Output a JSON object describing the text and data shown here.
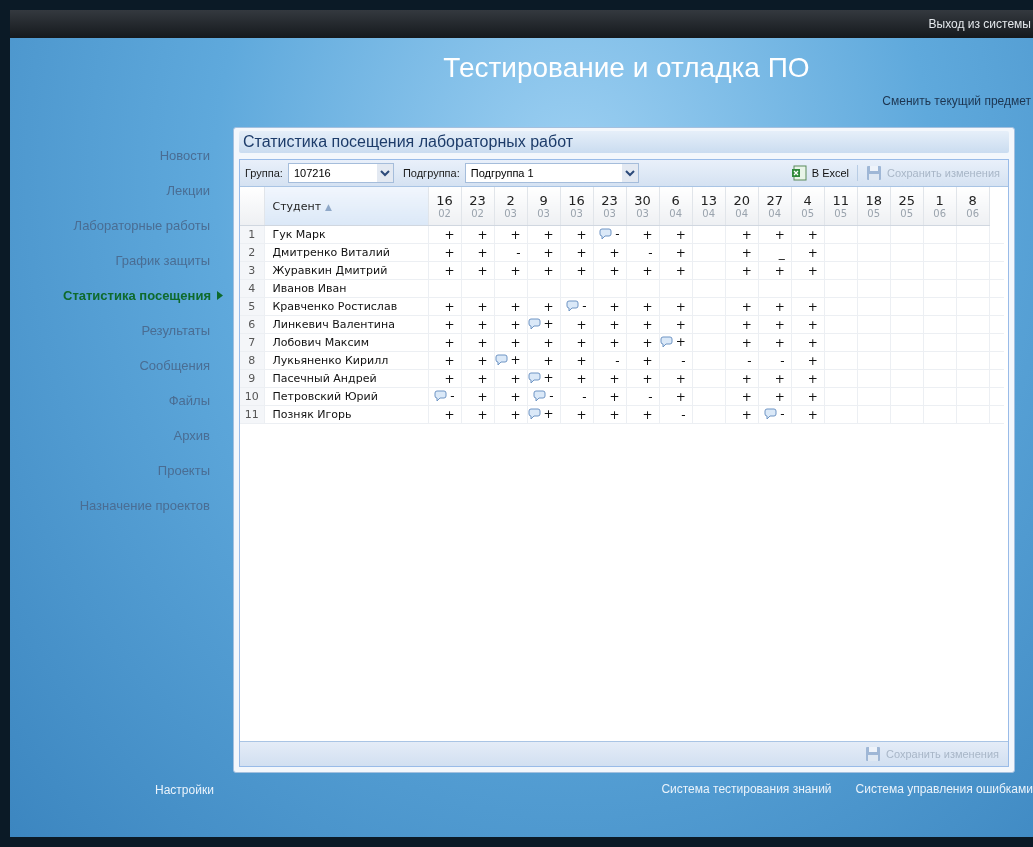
{
  "top_bar": {
    "logout_link": "Выход из системы"
  },
  "header": {
    "title": "Тестирование и отладка ПО",
    "change_subject_link": "Сменить текущий предмет"
  },
  "sidebar": {
    "items": [
      {
        "label": "Новости",
        "selected": false
      },
      {
        "label": "Лекции",
        "selected": false
      },
      {
        "label": "Лабораторные работы",
        "selected": false
      },
      {
        "label": "График защиты",
        "selected": false
      },
      {
        "label": "Статистика посещения",
        "selected": true
      },
      {
        "label": "Результаты",
        "selected": false
      },
      {
        "label": "Сообщения",
        "selected": false
      },
      {
        "label": "Файлы",
        "selected": false
      },
      {
        "label": "Архив",
        "selected": false
      },
      {
        "label": "Проекты",
        "selected": false
      },
      {
        "label": "Назначение проектов",
        "selected": false
      }
    ]
  },
  "panel": {
    "title": "Статистика посещения лабораторных работ",
    "toolbar": {
      "group_label": "Группа:",
      "group_value": "107216",
      "subgroup_label": "Подгруппа:",
      "subgroup_value": "Подгруппа 1",
      "excel_button": "В Excel",
      "save_button": {
        "label": "Сохранить изменения",
        "disabled": true
      }
    },
    "table": {
      "student_column": "Студент",
      "sort_indicator": "▲",
      "dates": [
        {
          "day": "16",
          "month": "02"
        },
        {
          "day": "23",
          "month": "02"
        },
        {
          "day": "2",
          "month": "03"
        },
        {
          "day": "9",
          "month": "03"
        },
        {
          "day": "16",
          "month": "03"
        },
        {
          "day": "23",
          "month": "03"
        },
        {
          "day": "30",
          "month": "03"
        },
        {
          "day": "6",
          "month": "04"
        },
        {
          "day": "13",
          "month": "04"
        },
        {
          "day": "20",
          "month": "04"
        },
        {
          "day": "27",
          "month": "04"
        },
        {
          "day": "4",
          "month": "05"
        },
        {
          "day": "11",
          "month": "05"
        },
        {
          "day": "18",
          "month": "05"
        },
        {
          "day": "25",
          "month": "05"
        },
        {
          "day": "1",
          "month": "06"
        },
        {
          "day": "8",
          "month": "06"
        }
      ],
      "rows": [
        {
          "num": "1",
          "student": "Гук Марк",
          "cells": [
            {
              "mark": "+",
              "comment": false
            },
            {
              "mark": "+",
              "comment": false
            },
            {
              "mark": "+",
              "comment": false
            },
            {
              "mark": "+",
              "comment": false
            },
            {
              "mark": "+",
              "comment": false
            },
            {
              "mark": "-",
              "comment": true
            },
            {
              "mark": "+",
              "comment": false
            },
            {
              "mark": "+",
              "comment": false
            },
            null,
            {
              "mark": "+",
              "comment": false
            },
            {
              "mark": "+",
              "comment": false
            },
            {
              "mark": "+",
              "comment": false
            },
            null,
            null,
            null,
            null,
            null
          ]
        },
        {
          "num": "2",
          "student": "Дмитренко Виталий",
          "cells": [
            {
              "mark": "+",
              "comment": false
            },
            {
              "mark": "+",
              "comment": false
            },
            {
              "mark": "-",
              "comment": false
            },
            {
              "mark": "+",
              "comment": false
            },
            {
              "mark": "+",
              "comment": false
            },
            {
              "mark": "+",
              "comment": false
            },
            {
              "mark": "-",
              "comment": false
            },
            {
              "mark": "+",
              "comment": false
            },
            null,
            {
              "mark": "+",
              "comment": false
            },
            {
              "mark": "_",
              "comment": false
            },
            {
              "mark": "+",
              "comment": false
            },
            null,
            null,
            null,
            null,
            null
          ]
        },
        {
          "num": "3",
          "student": "Журавкин Дмитрий",
          "cells": [
            {
              "mark": "+",
              "comment": false
            },
            {
              "mark": "+",
              "comment": false
            },
            {
              "mark": "+",
              "comment": false
            },
            {
              "mark": "+",
              "comment": false
            },
            {
              "mark": "+",
              "comment": false
            },
            {
              "mark": "+",
              "comment": false
            },
            {
              "mark": "+",
              "comment": false
            },
            {
              "mark": "+",
              "comment": false
            },
            null,
            {
              "mark": "+",
              "comment": false
            },
            {
              "mark": "+",
              "comment": false
            },
            {
              "mark": "+",
              "comment": false
            },
            null,
            null,
            null,
            null,
            null
          ]
        },
        {
          "num": "4",
          "student": "Иванов Иван",
          "cells": [
            null,
            null,
            null,
            null,
            null,
            null,
            null,
            null,
            null,
            null,
            null,
            null,
            null,
            null,
            null,
            null,
            null
          ]
        },
        {
          "num": "5",
          "student": "Кравченко Ростислав",
          "cells": [
            {
              "mark": "+",
              "comment": false
            },
            {
              "mark": "+",
              "comment": false
            },
            {
              "mark": "+",
              "comment": false
            },
            {
              "mark": "+",
              "comment": false
            },
            {
              "mark": "-",
              "comment": true
            },
            {
              "mark": "+",
              "comment": false
            },
            {
              "mark": "+",
              "comment": false
            },
            {
              "mark": "+",
              "comment": false
            },
            null,
            {
              "mark": "+",
              "comment": false
            },
            {
              "mark": "+",
              "comment": false
            },
            {
              "mark": "+",
              "comment": false
            },
            null,
            null,
            null,
            null,
            null
          ]
        },
        {
          "num": "6",
          "student": "Линкевич Валентина",
          "cells": [
            {
              "mark": "+",
              "comment": false
            },
            {
              "mark": "+",
              "comment": false
            },
            {
              "mark": "+",
              "comment": false
            },
            {
              "mark": "+",
              "comment": true
            },
            {
              "mark": "+",
              "comment": false
            },
            {
              "mark": "+",
              "comment": false
            },
            {
              "mark": "+",
              "comment": false
            },
            {
              "mark": "+",
              "comment": false
            },
            null,
            {
              "mark": "+",
              "comment": false
            },
            {
              "mark": "+",
              "comment": false
            },
            {
              "mark": "+",
              "comment": false
            },
            null,
            null,
            null,
            null,
            null
          ]
        },
        {
          "num": "7",
          "student": "Лобович Максим",
          "cells": [
            {
              "mark": "+",
              "comment": false
            },
            {
              "mark": "+",
              "comment": false
            },
            {
              "mark": "+",
              "comment": false
            },
            {
              "mark": "+",
              "comment": false
            },
            {
              "mark": "+",
              "comment": false
            },
            {
              "mark": "+",
              "comment": false
            },
            {
              "mark": "+",
              "comment": false
            },
            {
              "mark": "+",
              "comment": true
            },
            null,
            {
              "mark": "+",
              "comment": false
            },
            {
              "mark": "+",
              "comment": false
            },
            {
              "mark": "+",
              "comment": false
            },
            null,
            null,
            null,
            null,
            null
          ]
        },
        {
          "num": "8",
          "student": "Лукьяненко Кирилл",
          "cells": [
            {
              "mark": "+",
              "comment": false
            },
            {
              "mark": "+",
              "comment": false
            },
            {
              "mark": "+",
              "comment": true
            },
            {
              "mark": "+",
              "comment": false
            },
            {
              "mark": "+",
              "comment": false
            },
            {
              "mark": "-",
              "comment": false
            },
            {
              "mark": "+",
              "comment": false
            },
            {
              "mark": "-",
              "comment": false
            },
            null,
            {
              "mark": "-",
              "comment": false
            },
            {
              "mark": "-",
              "comment": false
            },
            {
              "mark": "+",
              "comment": false
            },
            null,
            null,
            null,
            null,
            null
          ]
        },
        {
          "num": "9",
          "student": "Пасечный Андрей",
          "cells": [
            {
              "mark": "+",
              "comment": false
            },
            {
              "mark": "+",
              "comment": false
            },
            {
              "mark": "+",
              "comment": false
            },
            {
              "mark": "+",
              "comment": true
            },
            {
              "mark": "+",
              "comment": false
            },
            {
              "mark": "+",
              "comment": false
            },
            {
              "mark": "+",
              "comment": false
            },
            {
              "mark": "+",
              "comment": false
            },
            null,
            {
              "mark": "+",
              "comment": false
            },
            {
              "mark": "+",
              "comment": false
            },
            {
              "mark": "+",
              "comment": false
            },
            null,
            null,
            null,
            null,
            null
          ]
        },
        {
          "num": "10",
          "student": "Петровский Юрий",
          "cells": [
            {
              "mark": "-",
              "comment": true
            },
            {
              "mark": "+",
              "comment": false
            },
            {
              "mark": "+",
              "comment": false
            },
            {
              "mark": "-",
              "comment": true
            },
            {
              "mark": "-",
              "comment": false
            },
            {
              "mark": "+",
              "comment": false
            },
            {
              "mark": "-",
              "comment": false
            },
            {
              "mark": "+",
              "comment": false
            },
            null,
            {
              "mark": "+",
              "comment": false
            },
            {
              "mark": "+",
              "comment": false
            },
            {
              "mark": "+",
              "comment": false
            },
            null,
            null,
            null,
            null,
            null
          ]
        },
        {
          "num": "11",
          "student": "Позняк Игорь",
          "cells": [
            {
              "mark": "+",
              "comment": false
            },
            {
              "mark": "+",
              "comment": false
            },
            {
              "mark": "+",
              "comment": false
            },
            {
              "mark": "+",
              "comment": true
            },
            {
              "mark": "+",
              "comment": false
            },
            {
              "mark": "+",
              "comment": false
            },
            {
              "mark": "+",
              "comment": false
            },
            {
              "mark": "-",
              "comment": false
            },
            null,
            {
              "mark": "+",
              "comment": false
            },
            {
              "mark": "-",
              "comment": true
            },
            {
              "mark": "+",
              "comment": false
            },
            null,
            null,
            null,
            null,
            null
          ]
        }
      ]
    },
    "bottom_save_button": {
      "label": "Сохранить изменения",
      "disabled": true
    }
  },
  "footer": {
    "left_links": [
      "Настройки"
    ],
    "right_links": [
      "Система тестирования знаний",
      "Система управления ошибками"
    ]
  }
}
